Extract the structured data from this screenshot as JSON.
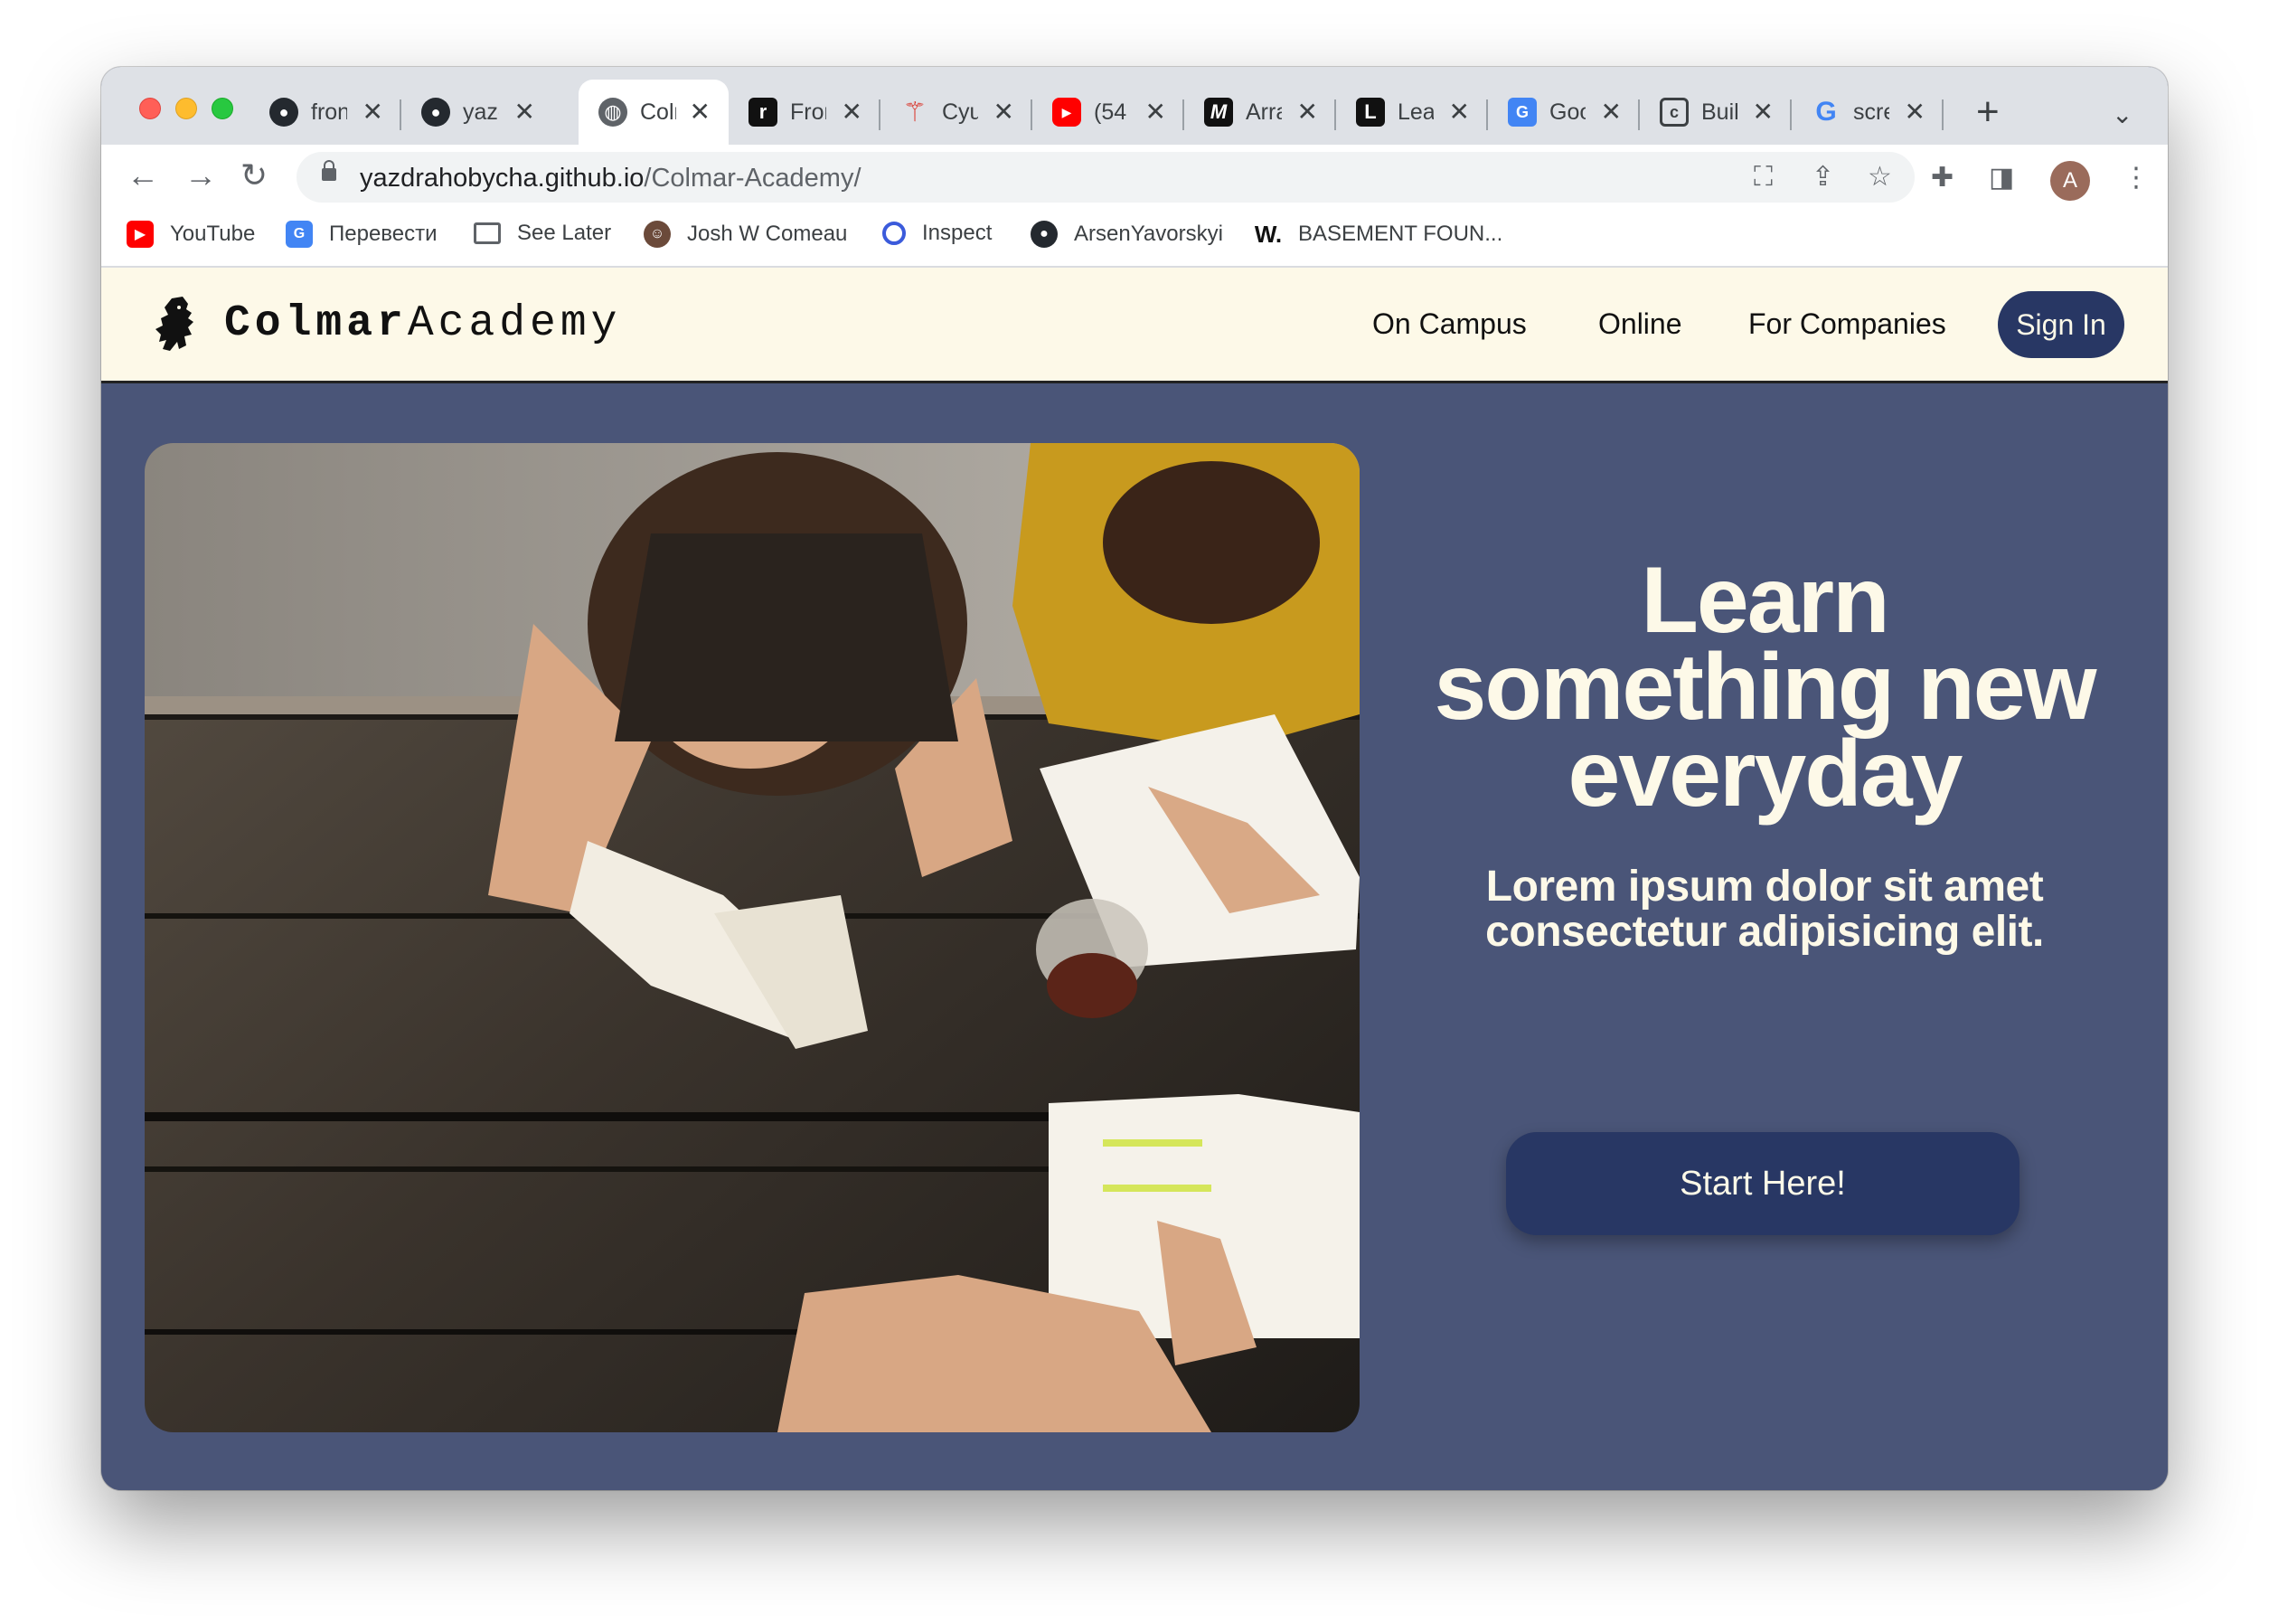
{
  "browser": {
    "tabs": [
      {
        "title": "fron",
        "icon": "github-icon",
        "active": false
      },
      {
        "title": "yazd",
        "icon": "github-icon",
        "active": false
      },
      {
        "title": "Colm",
        "icon": "globe-icon",
        "active": true
      },
      {
        "title": "Fron",
        "icon": "frontend-mentor-icon",
        "active": false
      },
      {
        "title": "Cyu",
        "icon": "cyu-icon",
        "active": false
      },
      {
        "title": "(54",
        "icon": "youtube-icon",
        "active": false
      },
      {
        "title": "Arra",
        "icon": "m-icon",
        "active": false
      },
      {
        "title": "Lea",
        "icon": "leetcode-icon",
        "active": false
      },
      {
        "title": "Goo",
        "icon": "google-translate-icon",
        "active": false
      },
      {
        "title": "Buil",
        "icon": "c-icon",
        "active": false
      },
      {
        "title": "scre",
        "icon": "google-icon",
        "active": false
      }
    ],
    "url_host": "yazdrahobycha.github.io",
    "url_path": "/Colmar-Academy/",
    "profile_initial": "A",
    "bookmarks": [
      {
        "label": "YouTube",
        "icon": "youtube-icon"
      },
      {
        "label": "Перевести",
        "icon": "google-translate-icon"
      },
      {
        "label": "See Later",
        "icon": "folder-icon"
      },
      {
        "label": "Josh W Comeau",
        "icon": "avatar-icon"
      },
      {
        "label": "Inspect",
        "icon": "inspect-icon"
      },
      {
        "label": "ArsenYavorskyi",
        "icon": "github-icon"
      },
      {
        "label": "BASEMENT FOUN...",
        "icon": "w-icon"
      }
    ]
  },
  "site": {
    "brand_bold": "Colmar",
    "brand_light": "Academy",
    "nav": [
      "On Campus",
      "Online",
      "For Companies"
    ],
    "signin": "Sign In",
    "headline": "Learn something new everyday",
    "subhead": "Lorem ipsum dolor sit amet consectetur adipisicing elit.",
    "cta": "Start Here!"
  },
  "colors": {
    "header_bg": "#fdf9e8",
    "page_bg": "#4a5578",
    "button_bg": "#283764",
    "text_light": "#fdf9e8"
  }
}
